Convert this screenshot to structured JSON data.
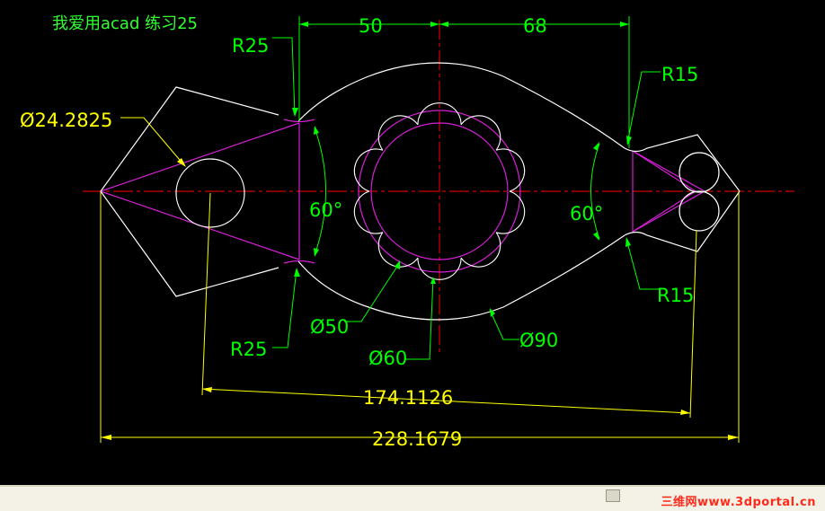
{
  "title": "我爱用acad 练习25",
  "colors": {
    "background": "#000000",
    "outline": "#ffffff",
    "construction": "#d61fd6",
    "centerline": "#ff0000",
    "dimension_green": "#00ff00",
    "dimension_yellow": "#ffff00",
    "title_green": "#33ff33",
    "watermark": "#ff2a1a"
  },
  "dimensions": {
    "horizontal_left": "50",
    "horizontal_right": "68",
    "radius_top_left": "R25",
    "radius_bottom_left": "R25",
    "radius_top_right": "R15",
    "radius_bottom_right": "R15",
    "diameter_small_hole": "Ø24.2825",
    "diameter_inner_circle": "Ø50",
    "diameter_outer_circle": "Ø60",
    "diameter_arc": "Ø90",
    "angle_left": "60°",
    "angle_right": "60°",
    "overall_inner": "174.1126",
    "overall_outer": "228.1679"
  },
  "watermark": "三维网www.3dportal.cn"
}
